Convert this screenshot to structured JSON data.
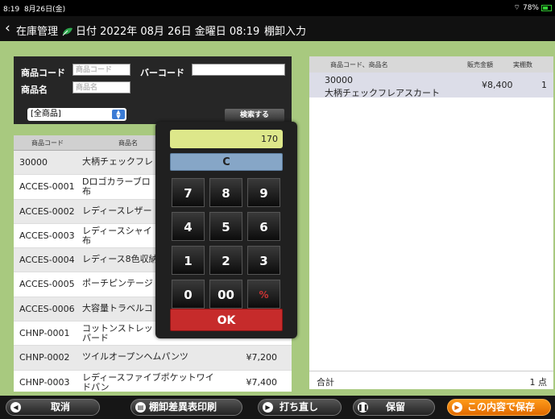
{
  "status": {
    "time": "8:19",
    "date": "8月26日(金)",
    "battery": "78%"
  },
  "nav": {
    "back_icon": "chevron-left-icon",
    "title_prefix": "在庫管理",
    "date_text": "日付 2022年 08月 26日 金曜日 08:19",
    "mode": "棚卸入力"
  },
  "search": {
    "code_label": "商品コード",
    "code_placeholder": "商品コード",
    "barcode_label": "バーコード",
    "barcode_value": "",
    "name_label": "商品名",
    "name_placeholder": "商品名",
    "category": "[全商品]",
    "search_button": "検索する"
  },
  "product_list": {
    "headers": [
      "商品コード",
      "商品名"
    ],
    "rows": [
      {
        "code": "30000",
        "name": "大柄チェックフレ",
        "price": ""
      },
      {
        "code": "ACCES-0001",
        "name": "Dロゴカラーブロ\n布",
        "price": ""
      },
      {
        "code": "ACCES-0002",
        "name": "レディースレザー",
        "price": ""
      },
      {
        "code": "ACCES-0003",
        "name": "レディースシャイ\n布",
        "price": ""
      },
      {
        "code": "ACCES-0004",
        "name": "レディース8色収納",
        "price": ""
      },
      {
        "code": "ACCES-0005",
        "name": "ポーチピンテージ",
        "price": ""
      },
      {
        "code": "ACCES-0006",
        "name": "大容量トラベルコ",
        "price": ""
      },
      {
        "code": "CHNP-0001",
        "name": "コットンストレッ\nパード",
        "price": ""
      },
      {
        "code": "CHNP-0002",
        "name": "ツイルオープンヘムパンツ",
        "price": "¥7,200"
      },
      {
        "code": "CHNP-0003",
        "name": "レディースファイブポケットワイ\nドパン",
        "price": "¥7,400"
      }
    ]
  },
  "calculator": {
    "display": "170",
    "clear": "C",
    "keys": [
      "7",
      "8",
      "9",
      "4",
      "5",
      "6",
      "1",
      "2",
      "3",
      "0",
      "00",
      "%"
    ],
    "ok": "OK"
  },
  "entry_list": {
    "headers": [
      "商品コード、商品名",
      "販売金額",
      "実棚数"
    ],
    "rows": [
      {
        "code": "30000",
        "name": "大柄チェックフレアスカート",
        "price": "¥8,400",
        "qty": "1"
      }
    ],
    "total_label": "合計",
    "total_value": "1 点"
  },
  "toolbar": {
    "cancel": "取消",
    "print": "棚卸差異表印刷",
    "redo": "打ち直し",
    "hold": "保留",
    "save": "この内容で保存"
  }
}
